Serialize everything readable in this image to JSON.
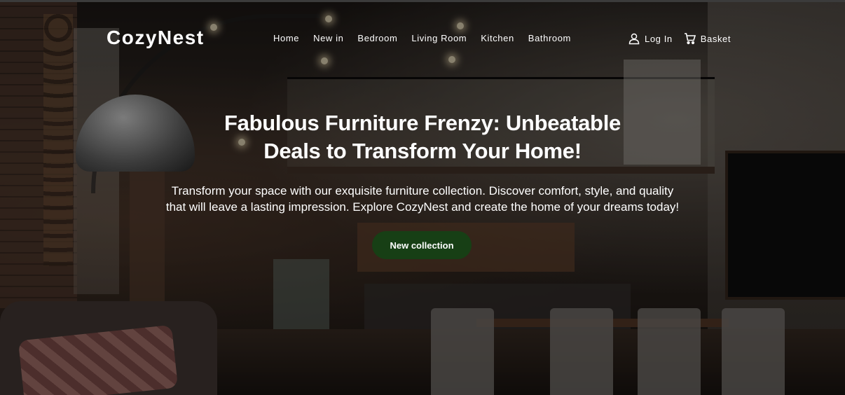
{
  "brand": {
    "name": "CozyNest"
  },
  "nav": {
    "links": [
      "Home",
      "New in",
      "Bedroom",
      "Living Room",
      "Kitchen",
      "Bathroom"
    ]
  },
  "account": {
    "login_label": "Log In",
    "login_icon": "user-icon",
    "basket_label": "Basket",
    "basket_icon": "cart-icon"
  },
  "hero": {
    "headline_line1": "Fabulous Furniture Frenzy: Unbeatable",
    "headline_line2": "Deals to Transform Your Home!",
    "subtext_line1": "Transform your space with our exquisite furniture collection. Discover comfort, style, and quality",
    "subtext_line2": "that will leave a lasting impression. Explore CozyNest and create the home of your dreams today!",
    "cta_label": "New collection"
  },
  "colors": {
    "cta_background": "#173f15",
    "text": "#ffffff"
  }
}
